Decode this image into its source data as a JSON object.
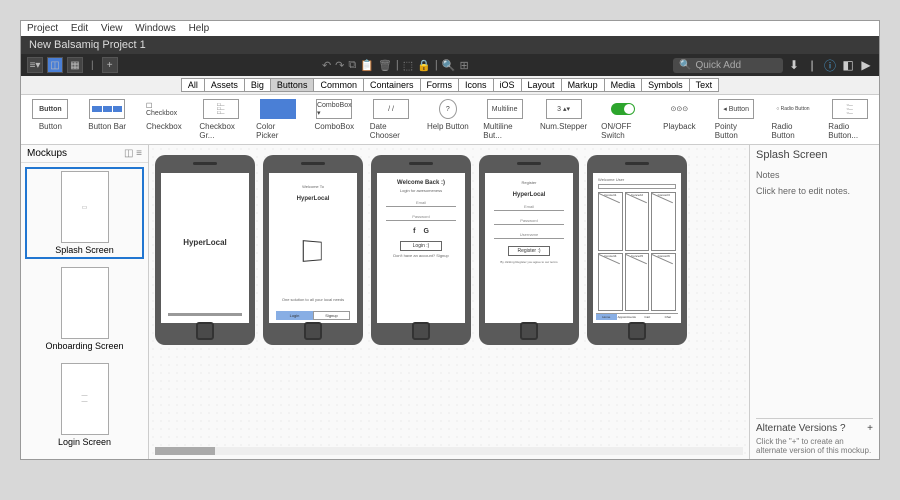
{
  "menubar": [
    "Project",
    "Edit",
    "View",
    "Windows",
    "Help"
  ],
  "title": "New Balsamiq Project 1",
  "quick_add": "Quick Add",
  "filters": [
    "All",
    "Assets",
    "Big",
    "Buttons",
    "Common",
    "Containers",
    "Forms",
    "Icons",
    "iOS",
    "Layout",
    "Markup",
    "Media",
    "Symbols",
    "Text"
  ],
  "filter_active": "Buttons",
  "palette": [
    {
      "label": "Button",
      "icon": "btn",
      "text": "Button"
    },
    {
      "label": "Button Bar",
      "icon": "bar"
    },
    {
      "label": "Checkbox",
      "icon": "check",
      "text": "☐ Checkbox"
    },
    {
      "label": "Checkbox Gr...",
      "icon": "lines"
    },
    {
      "label": "Color Picker",
      "icon": "picker"
    },
    {
      "label": "ComboBox",
      "icon": "combo",
      "text": "ComboBox ▾"
    },
    {
      "label": "Date Chooser",
      "icon": "date",
      "text": "/ /"
    },
    {
      "label": "Help Button",
      "icon": "help",
      "text": "?"
    },
    {
      "label": "Multiline But...",
      "icon": "multi",
      "text": "Multiline"
    },
    {
      "label": "Num.Stepper",
      "icon": "step",
      "text": "3 ▴▾"
    },
    {
      "label": "ON/OFF Switch",
      "icon": "switch"
    },
    {
      "label": "Playback",
      "icon": "play",
      "text": "⊙⊙⊙"
    },
    {
      "label": "Pointy Button",
      "icon": "pointy",
      "text": "◂ Button"
    },
    {
      "label": "Radio Button",
      "icon": "radio",
      "text": "○ Radio Button"
    },
    {
      "label": "Radio Button...",
      "icon": "radiog"
    }
  ],
  "sidebar": {
    "title": "Mockups",
    "items": [
      {
        "label": "Splash Screen",
        "active": true
      },
      {
        "label": "Onboarding Screen",
        "active": false
      },
      {
        "label": "Login Screen",
        "active": false
      }
    ]
  },
  "phones": {
    "p1": {
      "name": "HyperLocal"
    },
    "p2": {
      "welcome": "Welcome To",
      "name": "HyperLocal",
      "tag": "One solution to all your local needs",
      "login": "Login",
      "signup": "Signup"
    },
    "p3": {
      "title": "Welcome Back :)",
      "sub": "Login for awesomeness",
      "email": "Email",
      "password": "Password",
      "login": "Login :)",
      "noacct": "Don't have an account? Signup"
    },
    "p4": {
      "title": "Register",
      "name": "HyperLocal",
      "email": "Email",
      "password": "Password",
      "username": "Username",
      "register": "Register :)",
      "terms": "By clicking Register you agree to our terms"
    },
    "p5": {
      "welcome": "Welcome User",
      "cells": [
        "Concert1",
        "Concert2",
        "Concert3",
        "Concert4",
        "Concert5",
        "Concert6"
      ],
      "tabs": [
        "Home",
        "Appointments",
        "Cart",
        "Chat"
      ]
    }
  },
  "right": {
    "title": "Splash Screen",
    "notes_label": "Notes",
    "notes_hint": "Click here to edit notes.",
    "alt_title": "Alternate Versions",
    "alt_hint": "Click the \"+\" to create an alternate version of this mockup."
  }
}
